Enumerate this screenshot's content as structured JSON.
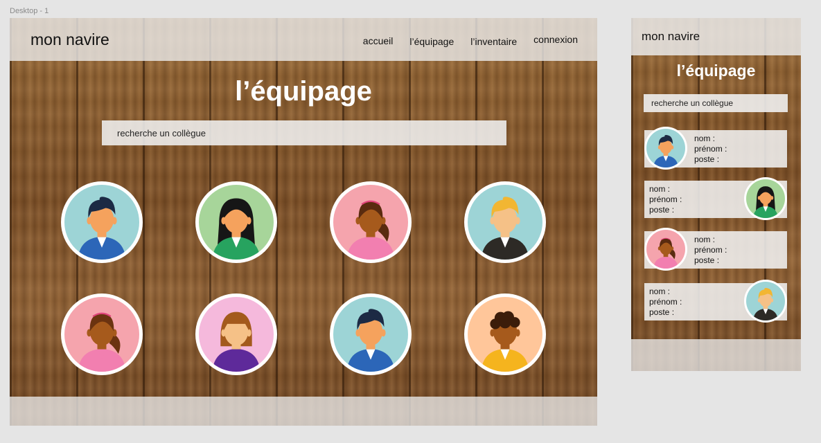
{
  "canvas": {
    "frame_label": "Desktop - 1"
  },
  "desktop": {
    "brand": "mon navire",
    "nav": [
      "accueil",
      "l’équipage",
      "l’inventaire",
      "connexion"
    ],
    "title": "l’équipage",
    "search_placeholder": "recherche un collègue",
    "avatars": [
      {
        "bg": "#9dd4d6",
        "skin": "#f5a25d",
        "hair": "#1c2a44",
        "shirt": "#2c66b8",
        "style": "short",
        "collar": "#ffffff"
      },
      {
        "bg": "#a7d59a",
        "skin": "#f5a25d",
        "hair": "#161616",
        "shirt": "#27a35f",
        "style": "long",
        "collar": "#ffffff"
      },
      {
        "bg": "#f5a4ad",
        "skin": "#a65a1c",
        "hair": "#5a2b0f",
        "shirt": "#f27fb0",
        "style": "bun",
        "collar": "#f27fb0"
      },
      {
        "bg": "#9dd4d6",
        "skin": "#f5c187",
        "hair": "#f2b632",
        "shirt": "#2d2a26",
        "style": "short",
        "collar": "#ffffff"
      },
      {
        "bg": "#f5a4ad",
        "skin": "#a65a1c",
        "hair": "#6b3310",
        "shirt": "#f27fb0",
        "style": "bun",
        "collar": "#f27fb0"
      },
      {
        "bg": "#f5b9dc",
        "skin": "#f5c187",
        "hair": "#a35a1c",
        "shirt": "#5e2a9a",
        "style": "bob",
        "collar": "#5e2a9a"
      },
      {
        "bg": "#9dd4d6",
        "skin": "#f5a25d",
        "hair": "#1c2a44",
        "shirt": "#2c66b8",
        "style": "short",
        "collar": "#ffffff"
      },
      {
        "bg": "#ffc69a",
        "skin": "#a65a1c",
        "hair": "#3b1d0a",
        "shirt": "#f5b41e",
        "style": "curly",
        "collar": "#ffffff"
      }
    ]
  },
  "mobile": {
    "brand": "mon navire",
    "title": "l’équipage",
    "search_placeholder": "recherche un collègue",
    "cards": [
      {
        "nom": "nom :",
        "prenom": "prénom :",
        "poste": "poste :",
        "avatar_side": "left",
        "avatar": 0
      },
      {
        "nom": "nom :",
        "prenom": "prénom :",
        "poste": "poste :",
        "avatar_side": "right",
        "avatar": 1
      },
      {
        "nom": "nom :",
        "prenom": "prénom :",
        "poste": "poste :",
        "avatar_side": "left",
        "avatar": 2
      },
      {
        "nom": "nom :",
        "prenom": "prénom :",
        "poste": "poste :",
        "avatar_side": "right",
        "avatar": 3
      }
    ]
  }
}
